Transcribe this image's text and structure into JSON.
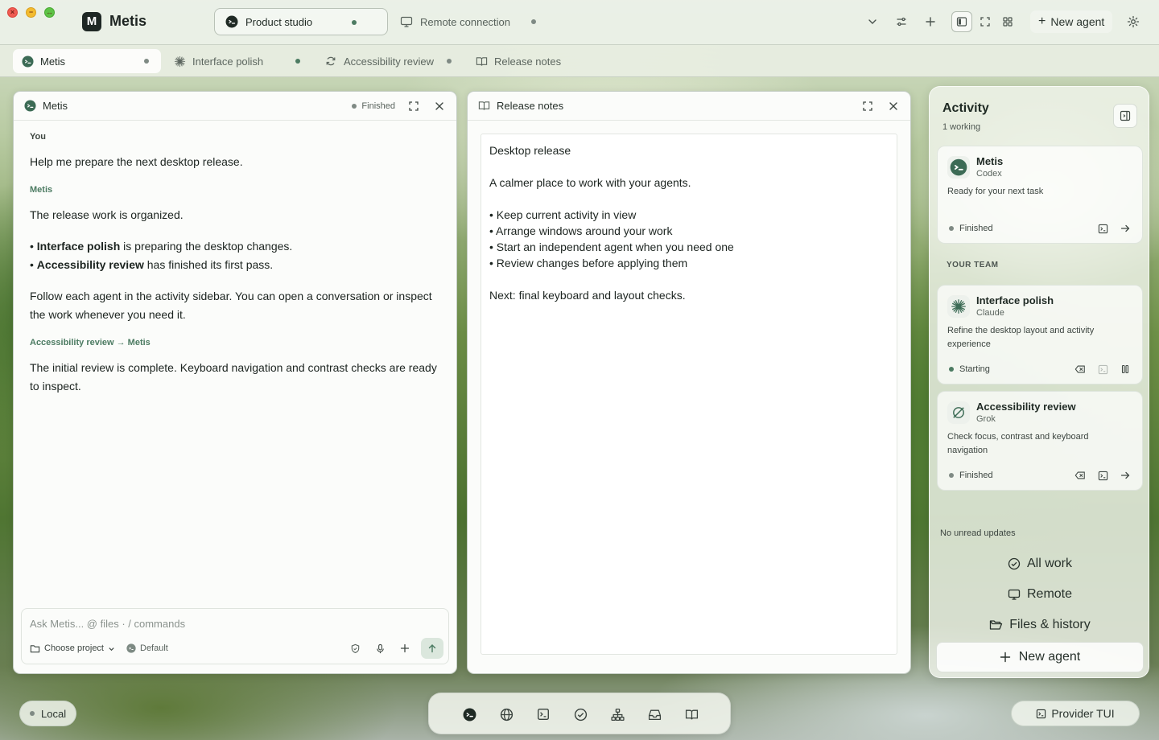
{
  "app": {
    "name": "Metis",
    "logo_letter": "M"
  },
  "window_tabs": [
    {
      "label": "Product studio"
    },
    {
      "label": "Remote connection"
    }
  ],
  "toolbar": {
    "new_agent_label": "New agent"
  },
  "sub_tabs": [
    {
      "label": "Metis"
    },
    {
      "label": "Interface polish"
    },
    {
      "label": "Accessibility review"
    },
    {
      "label": "Release notes"
    }
  ],
  "chat_panel": {
    "title": "Metis",
    "status": "Finished",
    "messages": {
      "you_label": "You",
      "you_text": "Help me prepare the next desktop release.",
      "metis_label": "Metis",
      "metis_intro": "The release work is organized.",
      "bullet1_bold": "Interface polish",
      "bullet1_rest": " is preparing the desktop changes.",
      "bullet2_bold": "Accessibility review",
      "bullet2_rest": " has finished its first pass.",
      "metis_follow": "Follow each agent in the activity sidebar. You can open a conversation or inspect the work whenever you need it.",
      "review_label": "Accessibility review → Metis",
      "review_text": "The initial review is complete. Keyboard navigation and contrast checks are ready to inspect."
    },
    "composer": {
      "placeholder": "Ask Metis...  @ files · / commands",
      "project_label": "Choose project",
      "model_label": "Default"
    }
  },
  "notes_panel": {
    "title": "Release notes",
    "lines": [
      "Desktop release",
      "",
      "A calmer place to work with your agents.",
      "",
      "• Keep current activity in view",
      "• Arrange windows around your work",
      "• Start an independent agent when you need one",
      "• Review changes before applying them",
      "",
      "Next: final keyboard and layout checks."
    ]
  },
  "activity": {
    "title": "Activity",
    "subtitle": "1 working",
    "main_card": {
      "name": "Metis",
      "provider": "Codex",
      "description": "Ready for your next task",
      "status": "Finished"
    },
    "team_label": "YOUR TEAM",
    "team": [
      {
        "name": "Interface polish",
        "provider": "Claude",
        "description": "Refine the desktop layout and activity experience",
        "status": "Starting"
      },
      {
        "name": "Accessibility review",
        "provider": "Grok",
        "description": "Check focus, contrast and keyboard navigation",
        "status": "Finished"
      }
    ],
    "no_unread": "No unread updates",
    "links": {
      "all_work": "All work",
      "remote": "Remote",
      "files_history": "Files & history"
    },
    "new_agent_label": "New agent"
  },
  "bottom": {
    "local_label": "Local",
    "provider_label": "Provider TUI"
  },
  "colors": {
    "accent": "#4c7b62",
    "close": "#ef5b52",
    "minimize": "#f3bb2f",
    "maximize": "#5ec346"
  }
}
